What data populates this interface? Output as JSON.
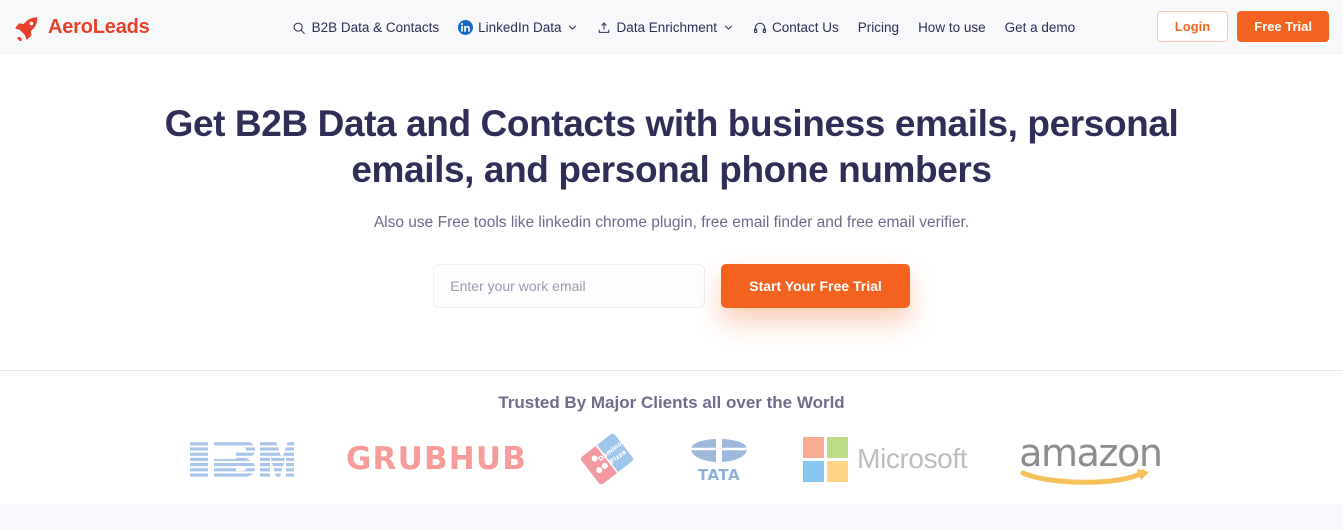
{
  "brand": {
    "name": "AeroLeads",
    "logo_icon": "rocket-icon",
    "color": "#e8412a"
  },
  "nav": {
    "items": [
      {
        "label": "B2B Data & Contacts",
        "icon": "search-icon",
        "has_dropdown": false
      },
      {
        "label": "LinkedIn Data",
        "icon": "linkedin-icon",
        "has_dropdown": true
      },
      {
        "label": "Data Enrichment",
        "icon": "upload-icon",
        "has_dropdown": true
      },
      {
        "label": "Contact Us",
        "icon": "headset-icon",
        "has_dropdown": false
      },
      {
        "label": "Pricing",
        "icon": "",
        "has_dropdown": false
      },
      {
        "label": "How to use",
        "icon": "",
        "has_dropdown": false
      },
      {
        "label": "Get a demo",
        "icon": "",
        "has_dropdown": false
      }
    ],
    "login_label": "Login",
    "trial_label": "Free Trial",
    "accent_color": "#f4621f"
  },
  "hero": {
    "title": "Get B2B Data and Contacts with business emails, personal emails, and personal phone numbers",
    "subtitle": "Also use Free tools like linkedin chrome plugin, free email finder and free email verifier.",
    "email_placeholder": "Enter your work email",
    "email_value": "",
    "cta_label": "Start Your Free Trial",
    "title_color": "#2f2e56"
  },
  "trusted": {
    "title": "Trusted By Major Clients all over the World",
    "logos": [
      {
        "name": "IBM",
        "icon": "ibm-logo"
      },
      {
        "name": "GRUBHUB",
        "icon": "grubhub-logo"
      },
      {
        "name": "Domino's Pizza",
        "icon": "dominos-logo"
      },
      {
        "name": "TATA",
        "icon": "tata-logo"
      },
      {
        "name": "Microsoft",
        "icon": "microsoft-logo"
      },
      {
        "name": "amazon",
        "icon": "amazon-logo"
      }
    ]
  }
}
